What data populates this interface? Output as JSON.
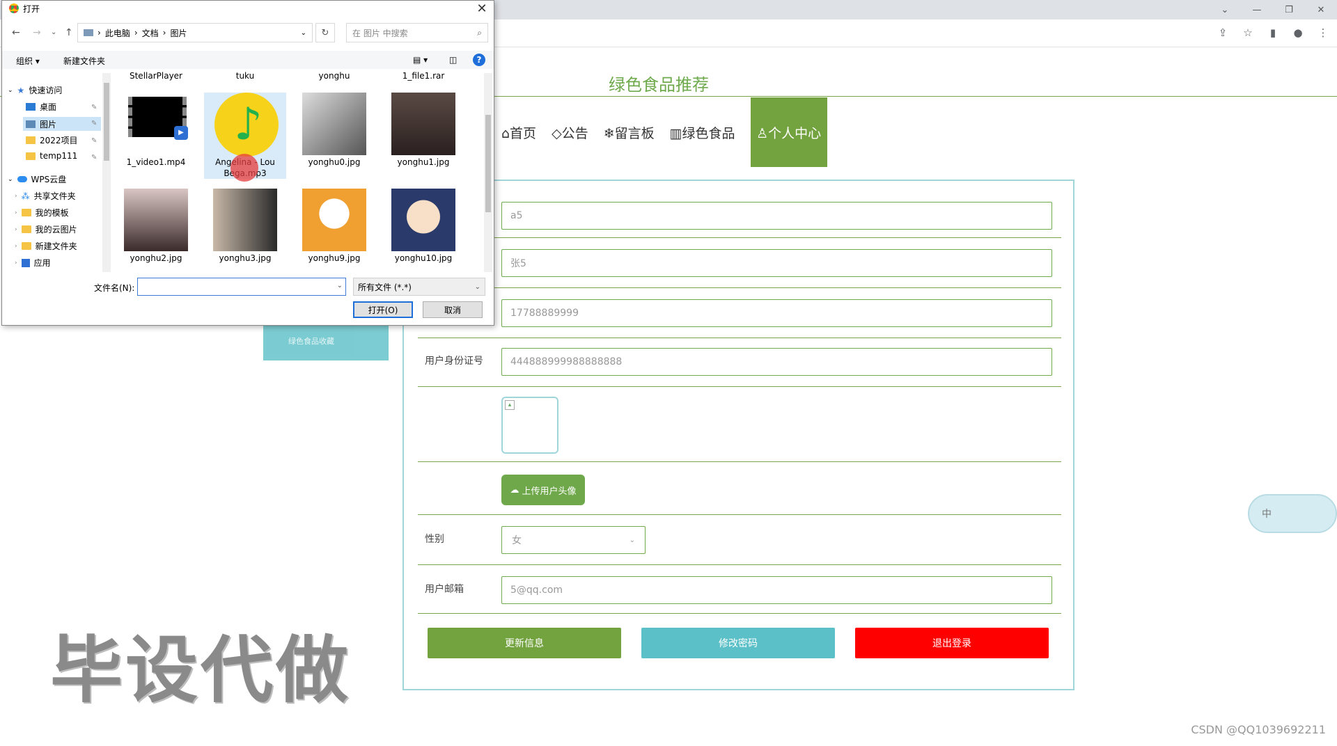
{
  "dialog": {
    "title": "打开",
    "path": [
      "此电脑",
      "文档",
      "图片"
    ],
    "search_placeholder": "在 图片 中搜索",
    "toolbar": {
      "organize": "组织 ▾",
      "new_folder": "新建文件夹"
    },
    "tree": {
      "quick_access": "快速访问",
      "desktop": "桌面",
      "pictures": "图片",
      "proj2022": "2022项目",
      "temp": "temp111",
      "wps_cloud": "WPS云盘",
      "shared": "共享文件夹",
      "templates": "我的模板",
      "cloud_pics": "我的云图片",
      "new_folder": "新建文件夹",
      "apps": "应用"
    },
    "files": {
      "f1": "StellarPlayer",
      "f2": "tuku",
      "f3": "yonghu",
      "f4": "1_file1.rar",
      "f5": "1_video1.mp4",
      "f6": "Angelina - Lou Bega.mp3",
      "f7": "yonghu0.jpg",
      "f8": "yonghu1.jpg",
      "f9": "yonghu2.jpg",
      "f10": "yonghu3.jpg",
      "f11": "yonghu9.jpg",
      "f12": "yonghu10.jpg"
    },
    "filename_label": "文件名(N):",
    "filetype": "所有文件 (*.*)",
    "open_button": "打开(O)",
    "cancel_button": "取消"
  },
  "site": {
    "title": "绿色食品推荐",
    "nav": {
      "home": "⌂首页",
      "notice": "◇公告",
      "board": "❄留言板",
      "food": "▥绿色食品",
      "center": "♙个人中心"
    },
    "side_tag": "绿色食品收藏"
  },
  "form": {
    "account": "a5",
    "name": "张5",
    "phone": "17788889999",
    "id_label": "用户身份证号",
    "id_value": "444888999988888888",
    "upload_button": "上传用户头像",
    "gender_label": "性别",
    "gender_value": "女",
    "email_label": "用户邮箱",
    "email_value": "5@qq.com",
    "update_button": "更新信息",
    "password_button": "修改密码",
    "logout_button": "退出登录"
  },
  "colors": {
    "green": "#73a33f",
    "teal": "#5bc0c8",
    "red": "#ff0000"
  },
  "watermark": "毕设代做",
  "csdn": "CSDN @QQ1039692211",
  "float_widget": "中"
}
